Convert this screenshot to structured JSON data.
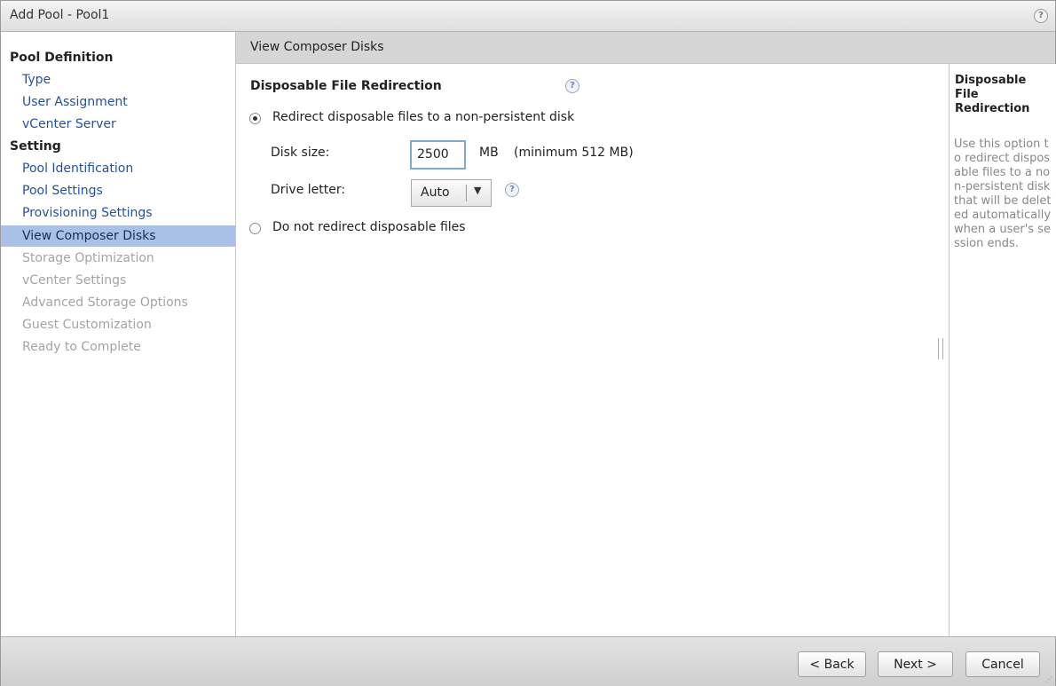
{
  "window": {
    "title": "Add Pool - Pool1"
  },
  "sidebar": {
    "sections": [
      {
        "header": "Pool Definition",
        "items": [
          "Type",
          "User Assignment",
          "vCenter Server"
        ]
      },
      {
        "header": "Setting",
        "items": [
          "Pool Identification",
          "Pool Settings",
          "Provisioning Settings",
          "View Composer Disks",
          "Storage Optimization",
          "vCenter Settings",
          "Advanced Storage Options",
          "Guest Customization",
          "Ready to Complete"
        ]
      }
    ],
    "selected": "View Composer Disks"
  },
  "main": {
    "header": "View Composer Disks",
    "section_title": "Disposable File Redirection",
    "option_redirect": "Redirect disposable files to a non-persistent disk",
    "disk_size_label": "Disk size:",
    "disk_size_value": "2500",
    "disk_size_unit": "MB",
    "disk_size_hint": "(minimum 512 MB)",
    "drive_letter_label": "Drive letter:",
    "drive_letter_value": "Auto",
    "option_no_redirect": "Do not redirect disposable files",
    "selected_option": "redirect"
  },
  "help_panel": {
    "title": "Disposable File Redirection",
    "body": "Use this option to redirect disposable files to a non-persistent disk that will be deleted automatically when a user's session ends."
  },
  "footer": {
    "back": "< Back",
    "next": "Next >",
    "cancel": "Cancel"
  },
  "icons": {
    "help": "help-icon",
    "dropdown": "chevron-down-icon"
  }
}
